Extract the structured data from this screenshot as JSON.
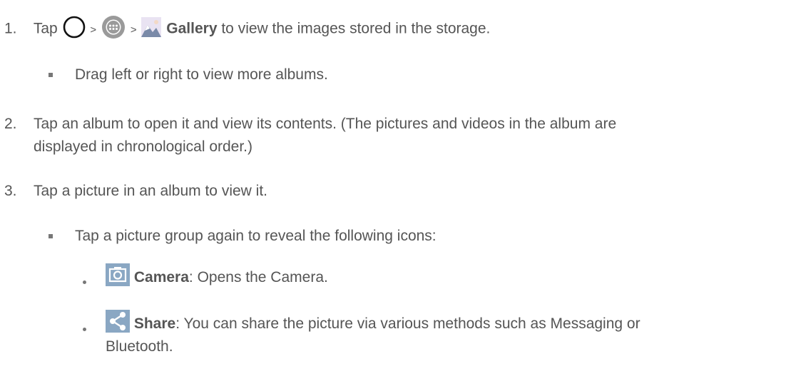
{
  "steps": [
    {
      "number": "1.",
      "prefix": "Tap",
      "sep1": ">",
      "sep2": ">",
      "bold": "Gallery",
      "suffix": "to view the images stored in the storage.",
      "sub": "Drag left or right to view more albums."
    },
    {
      "number": "2.",
      "line1": "Tap an album to open it and view its contents. (The pictures and videos in the album are",
      "line2": "displayed in chronological order.)"
    },
    {
      "number": "3.",
      "text": "Tap a picture in an album to view it.",
      "sub": "Tap a picture group again to reveal the following icons:",
      "items": [
        {
          "icon": "camera-icon",
          "bold": "Camera",
          "desc": ": Opens the Camera."
        },
        {
          "icon": "share-icon",
          "bold": "Share",
          "desc": ": You can share the picture via various methods such as Messaging or",
          "desc2": "Bluetooth."
        }
      ]
    }
  ]
}
